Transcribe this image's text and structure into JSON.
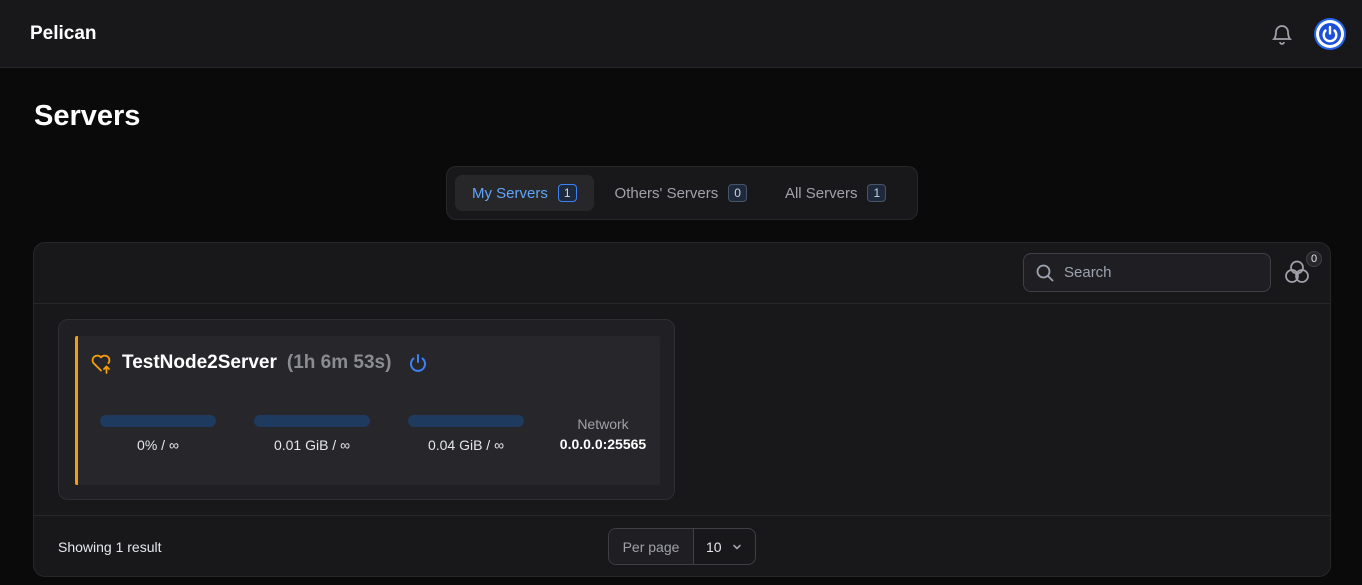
{
  "app": {
    "title": "Pelican"
  },
  "page": {
    "title": "Servers"
  },
  "tabs": [
    {
      "label": "My Servers",
      "count": "1",
      "active": true
    },
    {
      "label": "Others' Servers",
      "count": "0",
      "active": false
    },
    {
      "label": "All Servers",
      "count": "1",
      "active": false
    }
  ],
  "search": {
    "placeholder": "Search",
    "value": ""
  },
  "filter": {
    "count": "0"
  },
  "server": {
    "name": "TestNode2Server",
    "uptime": "(1h 6m 53s)",
    "status_color": "#f59e0b",
    "stats": [
      {
        "value": "0% / ∞",
        "fill": 0
      },
      {
        "value": "0.01 GiB / ∞",
        "fill": 0
      },
      {
        "value": "0.04 GiB / ∞",
        "fill": 0
      }
    ],
    "network_label": "Network",
    "network_address": "0.0.0.0:25565"
  },
  "footer": {
    "result_text": "Showing 1 result",
    "per_page_label": "Per page",
    "per_page_value": "10"
  },
  "icons": [
    "bell-icon",
    "power-icon",
    "search-icon",
    "filter-icon",
    "heart-status-icon",
    "chevron-down-icon"
  ]
}
